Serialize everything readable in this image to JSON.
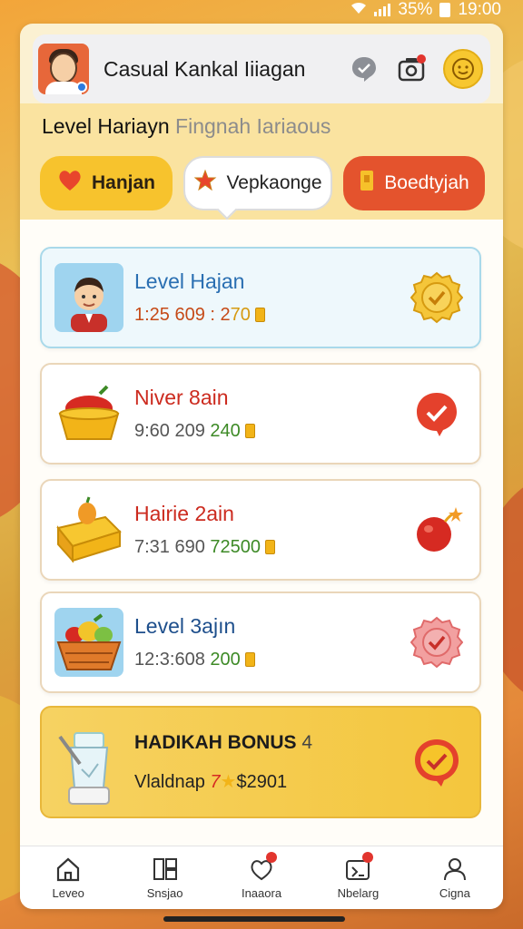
{
  "status_bar": {
    "battery_text": "35%",
    "time": "19:00"
  },
  "header": {
    "app_title": "Casual Kankal Iiiagan",
    "icons": [
      "avatar",
      "chat-icon",
      "camera-icon",
      "smile-icon"
    ]
  },
  "section": {
    "title": "Level Hariayn",
    "title_muted": "Fingnah Iariaous"
  },
  "tabs": [
    {
      "label": "Hanjan",
      "icon": "heart-icon"
    },
    {
      "label": "Vepkaonge",
      "icon": "star-icon"
    },
    {
      "label": "Boedtyjah",
      "icon": "ticket-icon"
    }
  ],
  "cards": [
    {
      "name": "Level Hajan",
      "stats": "1:25 609 : 2",
      "stats_highlight": "70",
      "name_color": "#2a6fb2",
      "stat_color": "#c64a17",
      "highlight_color": "#d69a10"
    },
    {
      "name": "Niver 8ain",
      "stats": "9:60 209",
      "stats_highlight": "240",
      "name_color": "#cc2b1f",
      "stat_color": "#555555",
      "highlight_color": "#3d8a26"
    },
    {
      "name": "Hairie 2ain",
      "stats": "7:31 690",
      "stats_highlight": "72500",
      "name_color": "#cc2b1f",
      "stat_color": "#555555",
      "highlight_color": "#3d8a26"
    },
    {
      "name": "Level 3ajın",
      "stats": "12:3:608",
      "stats_highlight": "200",
      "name_color": "#1e4f8c",
      "stat_color": "#555555",
      "highlight_color": "#3d8a26"
    }
  ],
  "bonus": {
    "title": "HADIKAH BONUS",
    "title_suffix": "4",
    "line_prefix": "Vlaldnap",
    "line_num": "7",
    "line_amount": "$2901"
  },
  "nav": [
    {
      "label": "Leveo",
      "icon": "home-icon",
      "dot": false
    },
    {
      "label": "Snsjao",
      "icon": "grid-icon",
      "dot": false
    },
    {
      "label": "Inaaora",
      "icon": "chat-heart-icon",
      "dot": true
    },
    {
      "label": "Nbelarg",
      "icon": "calendar-icon",
      "dot": true
    },
    {
      "label": "Cigna",
      "icon": "profile-icon",
      "dot": false
    }
  ],
  "colors": {
    "accent_yellow": "#f7c32d",
    "accent_red": "#e4532d",
    "panel": "#fbf1d2"
  }
}
